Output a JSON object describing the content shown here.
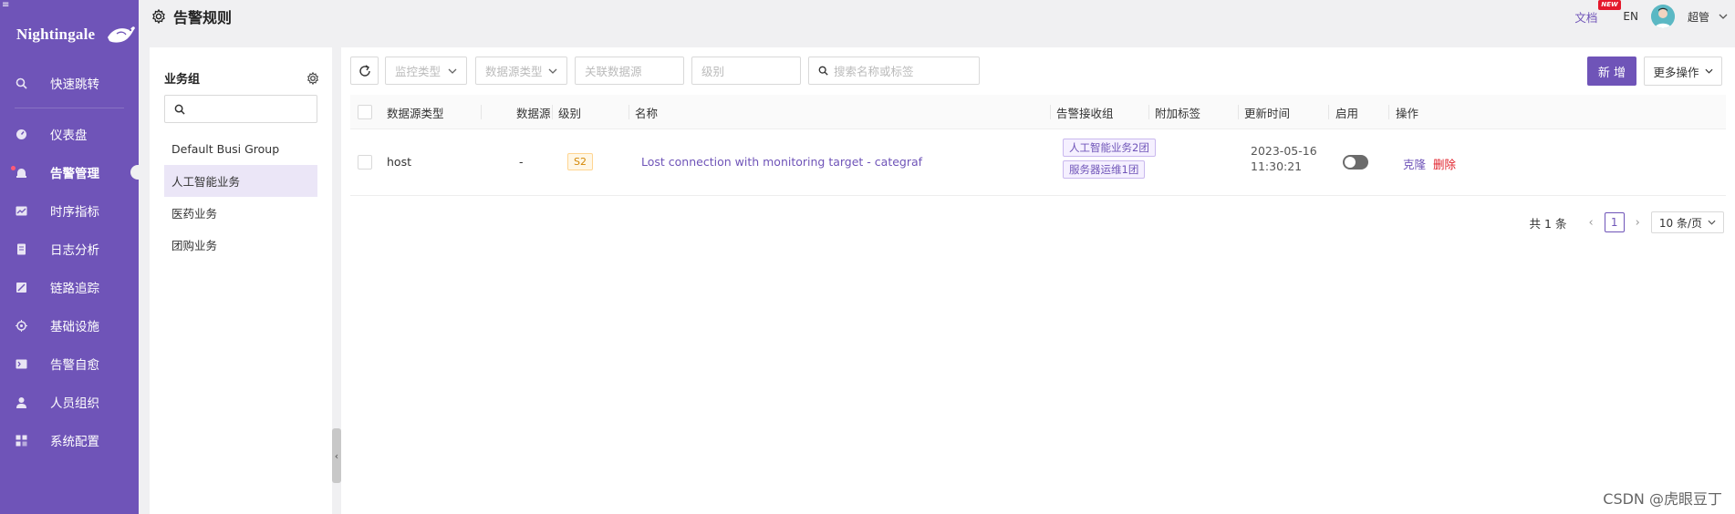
{
  "app": {
    "name": "Nightingale"
  },
  "colors": {
    "accent": "#6f54b8",
    "sidebar_bg": "#6f54b8",
    "danger": "#e0202a",
    "tag_warn": "#d48806"
  },
  "sidebar": {
    "items": [
      {
        "label": "快速跳转",
        "icon": "search-icon"
      },
      {
        "label": "仪表盘",
        "icon": "dashboard-icon"
      },
      {
        "label": "告警管理",
        "icon": "alarm-bell-icon",
        "active": true
      },
      {
        "label": "时序指标",
        "icon": "line-chart-icon"
      },
      {
        "label": "日志分析",
        "icon": "log-file-icon"
      },
      {
        "label": "链路追踪",
        "icon": "trace-icon"
      },
      {
        "label": "基础设施",
        "icon": "infrastructure-icon"
      },
      {
        "label": "告警自愈",
        "icon": "terminal-icon"
      },
      {
        "label": "人员组织",
        "icon": "user-icon"
      },
      {
        "label": "系统配置",
        "icon": "grid-settings-icon"
      }
    ]
  },
  "header": {
    "title": "告警规则",
    "docs_label": "文档",
    "new_badge": "NEW",
    "lang": "EN",
    "username": "超管"
  },
  "groups": {
    "title": "业务组",
    "search_placeholder": "",
    "items": [
      {
        "label": "Default Busi Group"
      },
      {
        "label": "人工智能业务",
        "selected": true
      },
      {
        "label": "医药业务"
      },
      {
        "label": "团购业务"
      }
    ]
  },
  "toolbar": {
    "monitor_type_placeholder": "监控类型",
    "datasource_type_placeholder": "数据源类型",
    "datasource_placeholder": "关联数据源",
    "level_placeholder": "级别",
    "search_placeholder": "搜索名称或标签",
    "add_label": "新 增",
    "more_label": "更多操作"
  },
  "table": {
    "columns": [
      "数据源类型",
      "数据源",
      "级别",
      "名称",
      "告警接收组",
      "附加标签",
      "更新时间",
      "启用",
      "操作"
    ],
    "rows": [
      {
        "datasource_type": "host",
        "datasource": "-",
        "level": "S2",
        "name": "Lost connection with monitoring target - categraf",
        "teams": [
          "人工智能业务2团",
          "服务器运维1团"
        ],
        "tags": "",
        "update_date": "2023-05-16",
        "update_time": "11:30:21",
        "enabled": false,
        "op_clone": "克隆",
        "op_delete": "删除"
      }
    ]
  },
  "pagination": {
    "total_label": "共 1 条",
    "current_page": "1",
    "page_size": "10 条/页"
  },
  "watermark": "CSDN @虎眼豆丁"
}
